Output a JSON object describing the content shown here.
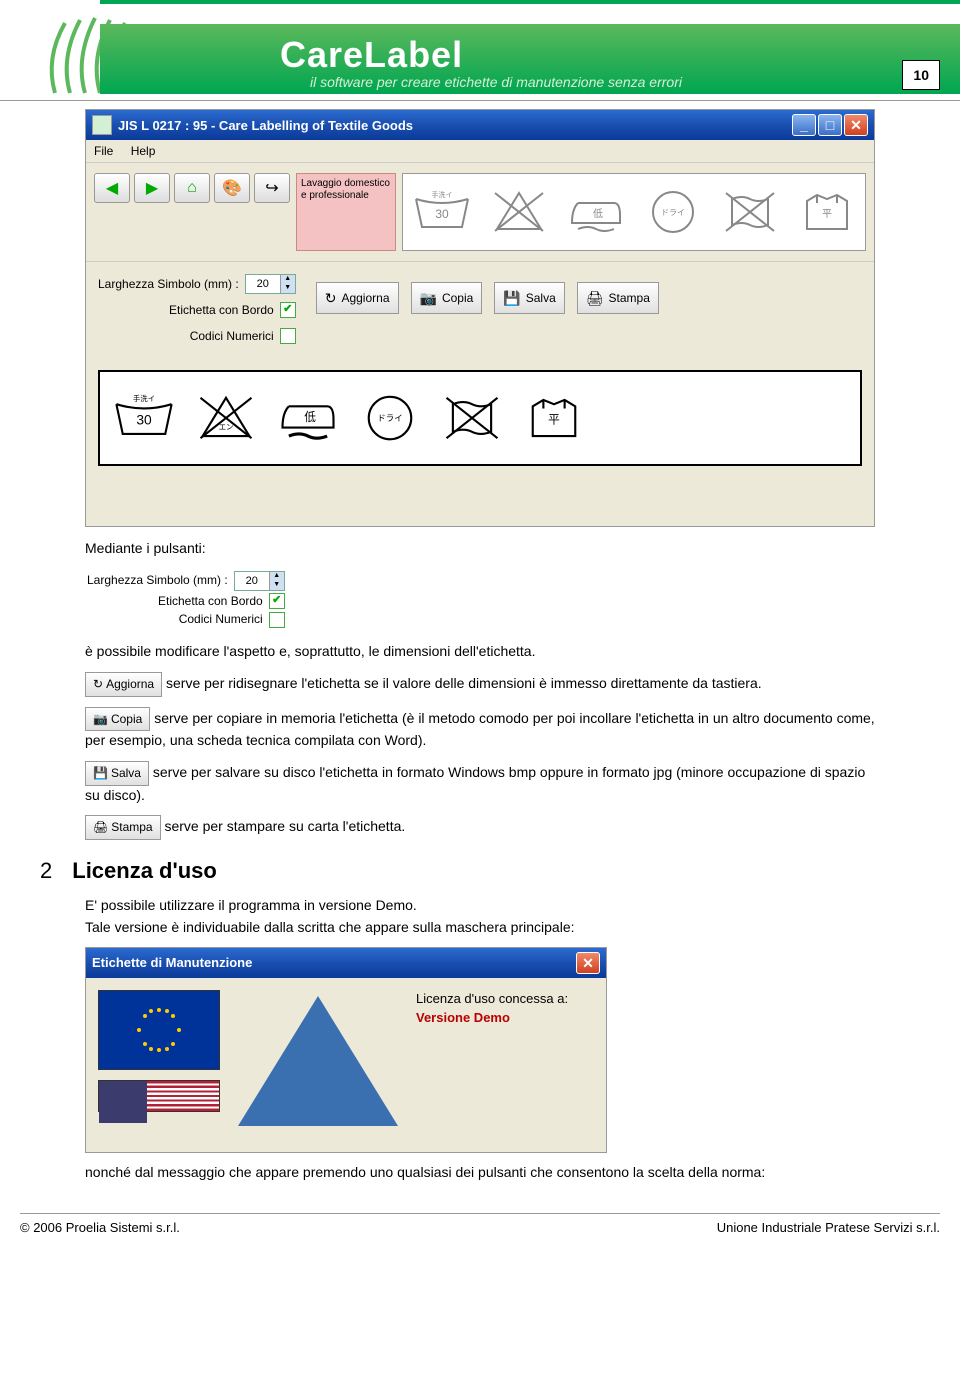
{
  "header": {
    "title": "CareLabel",
    "subtitle": "il software per creare etichette di manutenzione senza errori",
    "page_number": "10"
  },
  "window": {
    "title": "JIS L 0217 : 95 - Care Labelling of Textile Goods",
    "menu": {
      "file": "File",
      "help": "Help"
    },
    "pink_tile": "Lavaggio domestico e professionale",
    "options": {
      "width_label": "Larghezza Simbolo (mm) :",
      "width_value": "20",
      "border_label": "Etichetta con Bordo",
      "codes_label": "Codici Numerici"
    },
    "buttons": {
      "aggiorna": "Aggiorna",
      "copia": "Copia",
      "salva": "Salva",
      "stampa": "Stampa"
    }
  },
  "body": {
    "intro": "Mediante i pulsanti:",
    "mini": {
      "width_label": "Larghezza Simbolo (mm) :",
      "width_value": "20",
      "border_label": "Etichetta con Bordo",
      "codes_label": "Codici Numerici"
    },
    "p1": "è possibile modificare l'aspetto e, soprattutto, le dimensioni dell'etichetta.",
    "aggiorna_desc": " serve per ridisegnare l'etichetta se il valore delle dimensioni è immesso direttamente da tastiera.",
    "copia_desc": " serve per copiare in memoria l'etichetta (è il metodo comodo per poi incollare l'etichetta in un altro documento come, per esempio, una scheda tecnica compilata con Word).",
    "salva_desc": " serve per salvare su disco l'etichetta in formato Windows bmp oppure in formato jpg (minore occupazione di spazio su disco).",
    "stampa_desc": "serve per stampare su carta l'etichetta."
  },
  "section2": {
    "num": "2",
    "title": "Licenza d'uso",
    "p1": "E' possibile utilizzare il programma in versione Demo.",
    "p2": "Tale versione è individuabile dalla scritta che appare sulla maschera principale:",
    "license_window_title": "Etichette di Manutenzione",
    "license_label": "Licenza d'uso concessa a:",
    "license_value": "Versione Demo",
    "p3": "nonché dal messaggio che appare premendo uno qualsiasi dei pulsanti che consentono la scelta della norma:"
  },
  "footer": {
    "left": "© 2006 Proelia Sistemi s.r.l.",
    "right": "Unione Industriale Pratese Servizi s.r.l."
  }
}
